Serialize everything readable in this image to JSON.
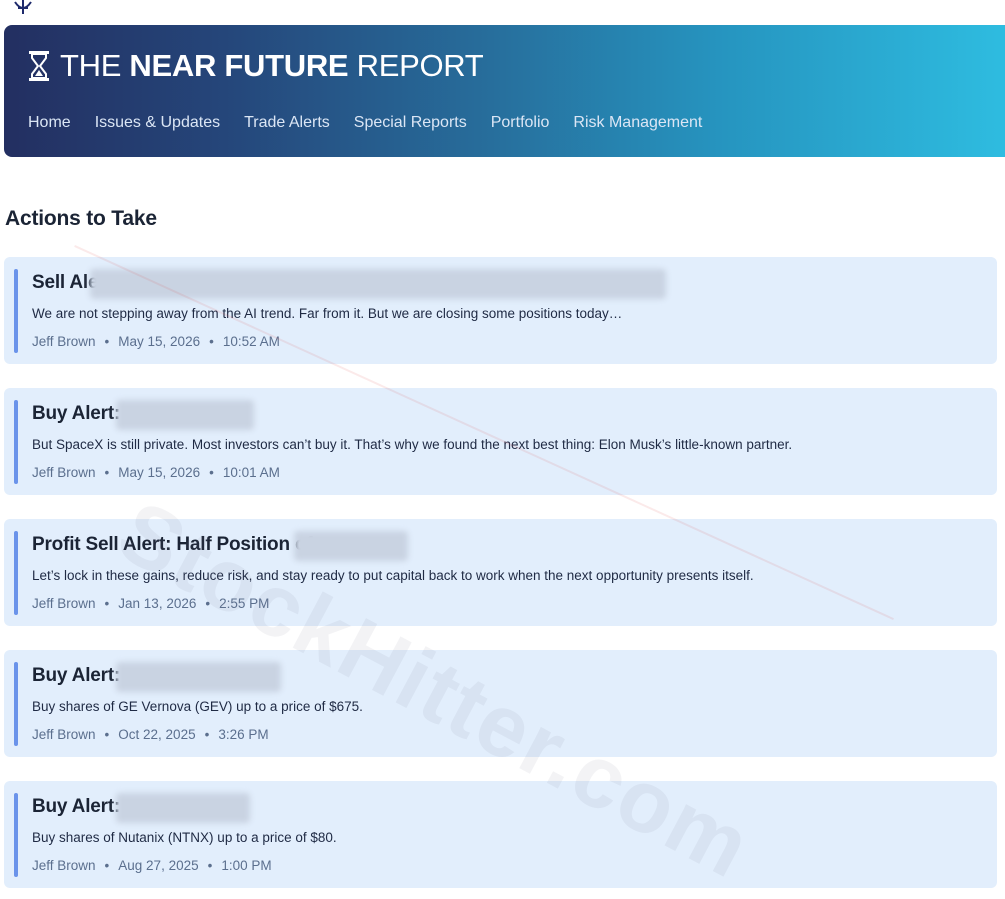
{
  "brand": {
    "part1": "THE ",
    "part2": "NEAR FUTURE",
    "part3": " REPORT"
  },
  "nav": [
    "Home",
    "Issues & Updates",
    "Trade Alerts",
    "Special Reports",
    "Portfolio",
    "Risk Management"
  ],
  "section_title": "Actions to Take",
  "watermark": "StockHitter.com",
  "cards": [
    {
      "title": "Sell Ale",
      "summary": "We are not stepping away from the AI trend. Far from it. But we are closing some positions today…",
      "author": "Jeff Brown",
      "date": "May 15, 2026",
      "time": "10:52 AM"
    },
    {
      "title": "Buy Alert:",
      "summary": "But SpaceX is still private. Most investors can’t buy it. That’s why we found the next best thing: Elon Musk’s little-known partner.",
      "author": "Jeff Brown",
      "date": "May 15, 2026",
      "time": "10:01 AM"
    },
    {
      "title": "Profit Sell Alert: Half Position of",
      "summary": "Let’s lock in these gains, reduce risk, and stay ready to put capital back to work when the next opportunity presents itself.",
      "author": "Jeff Brown",
      "date": "Jan 13, 2026",
      "time": "2:55 PM"
    },
    {
      "title": "Buy Alert:",
      "summary": "Buy shares of GE Vernova (GEV) up to a price of $675.",
      "author": "Jeff Brown",
      "date": "Oct 22, 2025",
      "time": "3:26 PM"
    },
    {
      "title": "Buy Alert:",
      "summary": "Buy shares of Nutanix (NTNX) up to a price of $80.",
      "author": "Jeff Brown",
      "date": "Aug 27, 2025",
      "time": "1:00 PM"
    }
  ],
  "colors": {
    "header_start": "#232f61",
    "header_end": "#2ebce0",
    "card_bg": "#e2eefc",
    "card_bar": "#6a93ea"
  }
}
